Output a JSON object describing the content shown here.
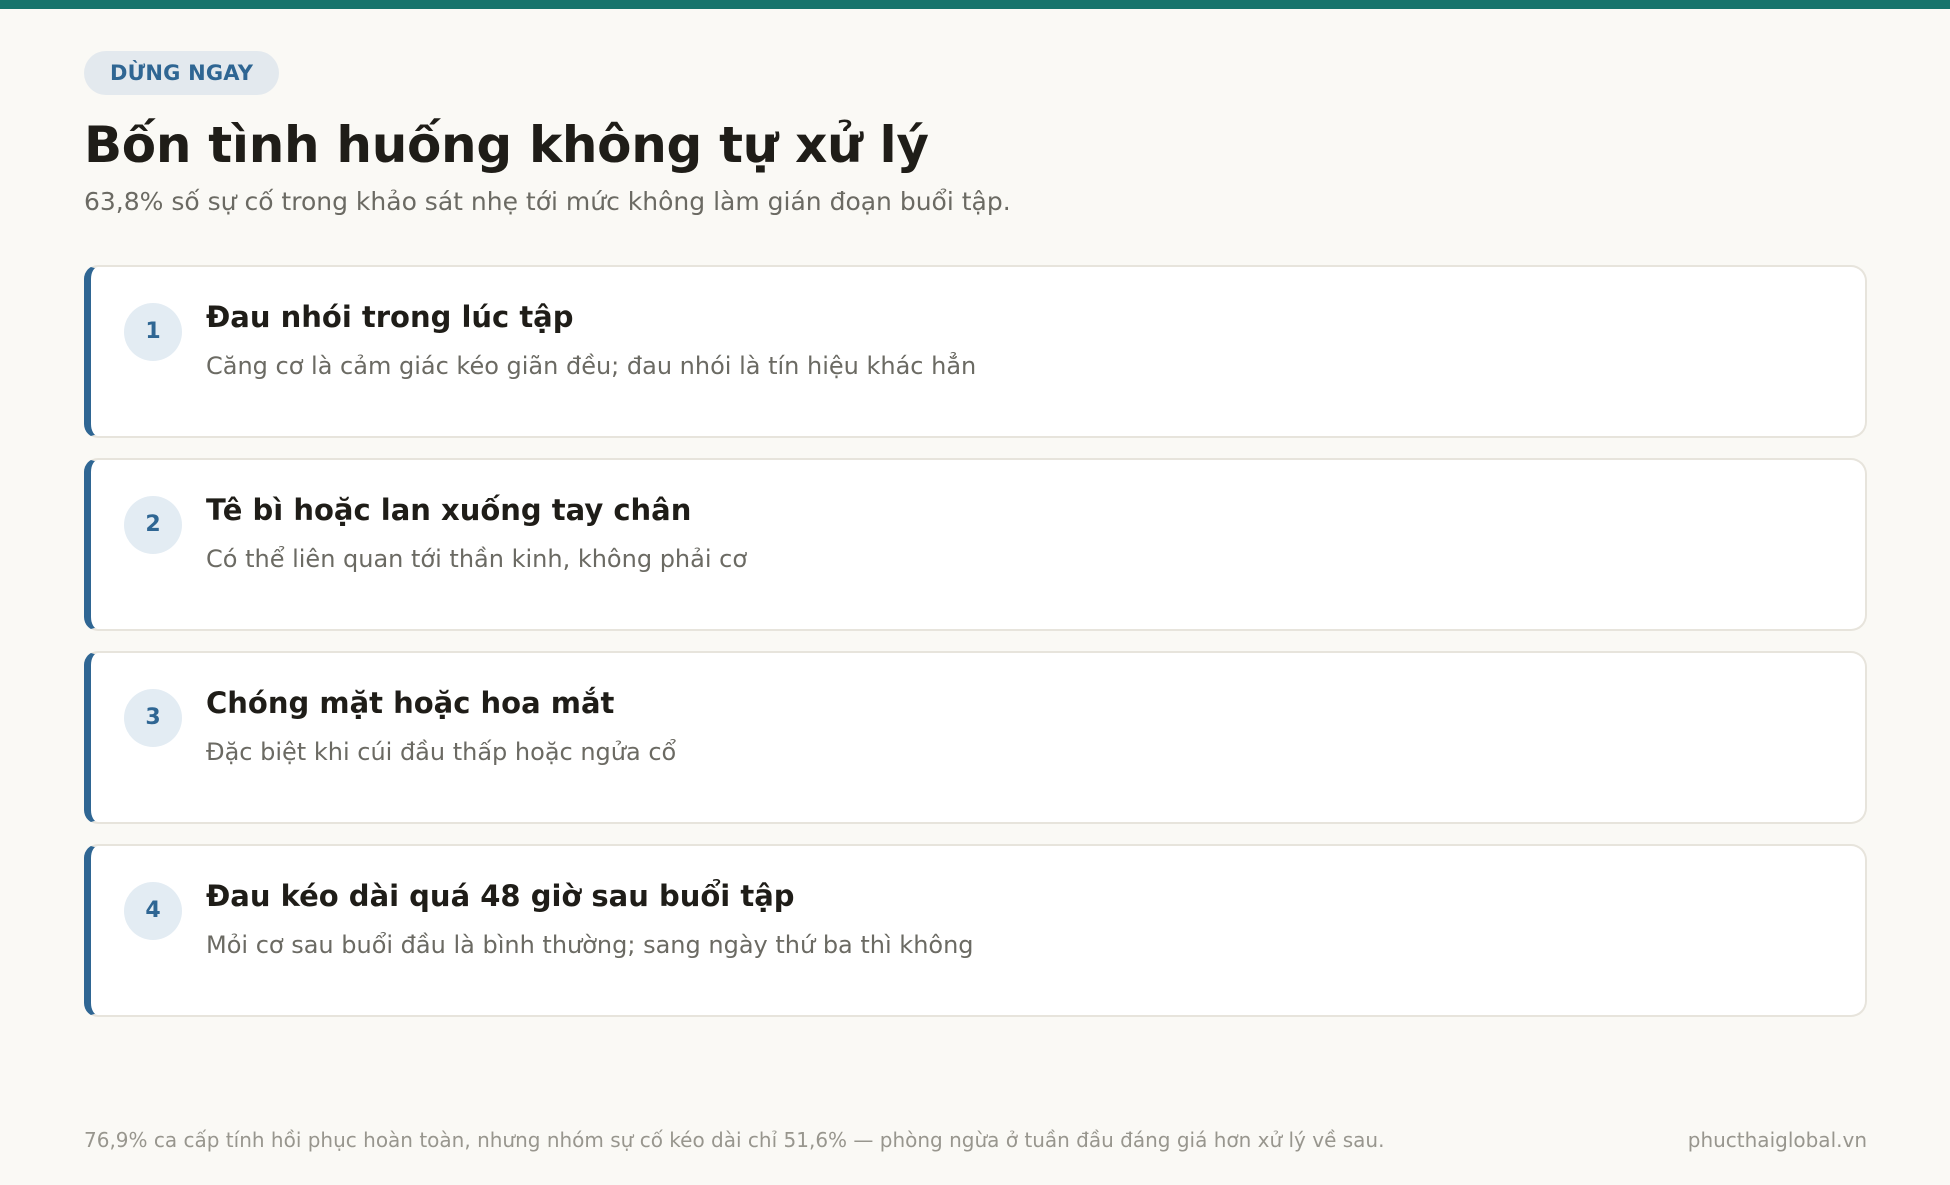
{
  "header": {
    "tag": "DỪNG NGAY",
    "title": "Bốn tình huống không tự xử lý",
    "subtitle": "63,8% số sự cố trong khảo sát nhẹ tới mức không làm gián đoạn buổi tập."
  },
  "items": [
    {
      "number": "1",
      "title": "Đau nhói trong lúc tập",
      "description": "Căng cơ là cảm giác kéo giãn đều; đau nhói là tín hiệu khác hẳn"
    },
    {
      "number": "2",
      "title": "Tê bì hoặc lan xuống tay chân",
      "description": "Có thể liên quan tới thần kinh, không phải cơ"
    },
    {
      "number": "3",
      "title": "Chóng mặt hoặc hoa mắt",
      "description": "Đặc biệt khi cúi đầu thấp hoặc ngửa cổ"
    },
    {
      "number": "4",
      "title": "Đau kéo dài quá 48 giờ sau buổi tập",
      "description": "Mỏi cơ sau buổi đầu là bình thường; sang ngày thứ ba thì không"
    }
  ],
  "footer": {
    "note": "76,9% ca cấp tính hồi phục hoàn toàn, nhưng nhóm sự cố kéo dài chỉ 51,6% — phòng ngừa ở tuần đầu đáng giá hơn xử lý về sau.",
    "site": "phucthaiglobal.vn"
  },
  "colors": {
    "accent": "#2f6693",
    "top_bar": "#17746c",
    "background": "#faf9f5"
  }
}
